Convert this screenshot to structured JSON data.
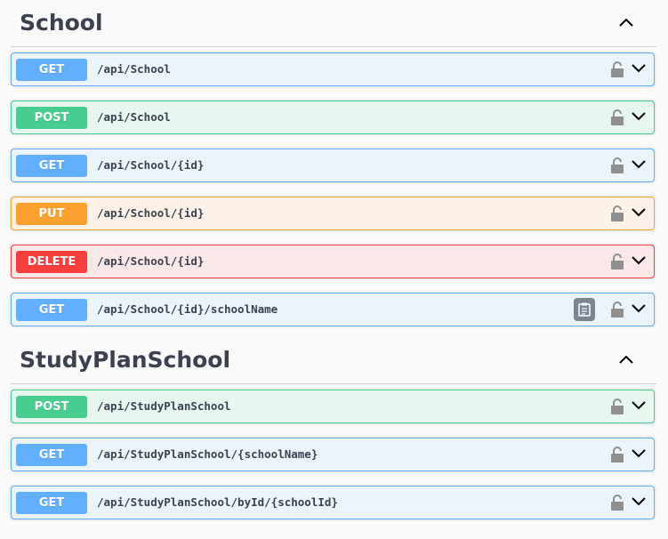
{
  "sections": [
    {
      "title": "School",
      "operations": [
        {
          "method": "GET",
          "path": "/api/School"
        },
        {
          "method": "POST",
          "path": "/api/School"
        },
        {
          "method": "GET",
          "path": "/api/School/{id}"
        },
        {
          "method": "PUT",
          "path": "/api/School/{id}"
        },
        {
          "method": "DELETE",
          "path": "/api/School/{id}"
        },
        {
          "method": "GET",
          "path": "/api/School/{id}/schoolName"
        }
      ]
    },
    {
      "title": "StudyPlanSchool",
      "operations": [
        {
          "method": "POST",
          "path": "/api/StudyPlanSchool"
        },
        {
          "method": "GET",
          "path": "/api/StudyPlanSchool/{schoolName}"
        },
        {
          "method": "GET",
          "path": "/api/StudyPlanSchool/byId/{schoolId}"
        }
      ]
    }
  ],
  "colors": {
    "get": "#61affe",
    "post": "#49cc90",
    "put": "#fca130",
    "delete": "#f93e3e"
  },
  "icons": {
    "collapse": "chevron-up-icon",
    "lock": "unlocked-icon",
    "expand": "chevron-down-icon",
    "copy": "clipboard-icon"
  }
}
